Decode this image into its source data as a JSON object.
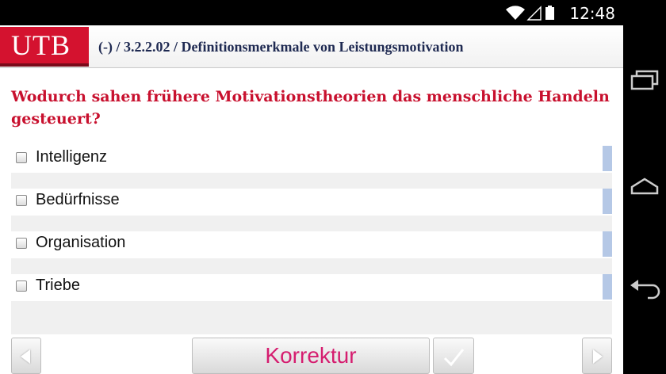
{
  "status_bar": {
    "time": "12:48",
    "icons": [
      "wifi-icon",
      "signal-icon",
      "battery-icon"
    ]
  },
  "header": {
    "logo": "UTB",
    "breadcrumb": "(-) / 3.2.2.02 / Definitionsmerkmale von Leistungsmotivation"
  },
  "question": "Wodurch sahen frühere Motivationstheorien das menschliche Handeln gesteuert?",
  "answers": [
    {
      "label": "Intelligenz",
      "checked": false
    },
    {
      "label": "Bedürfnisse",
      "checked": false
    },
    {
      "label": "Organisation",
      "checked": false
    },
    {
      "label": "Triebe",
      "checked": false
    }
  ],
  "toolbar": {
    "prev_icon": "arrow-left-icon",
    "korrektur_label": "Korrektur",
    "check_icon": "checkmark-icon",
    "next_icon": "arrow-right-icon"
  },
  "nav_bar": {
    "icons": [
      "recent-apps-icon",
      "home-icon",
      "back-icon"
    ]
  },
  "colors": {
    "brand_red": "#d4122f",
    "question_red": "#c8102e",
    "korrektur_pink": "#d51d6f",
    "answer_bar_blue": "#b5c8e6"
  }
}
